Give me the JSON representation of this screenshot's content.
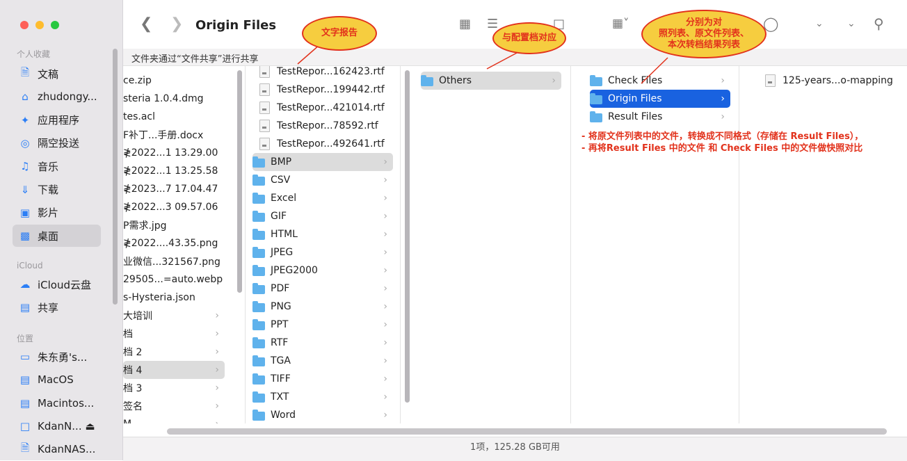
{
  "window": {
    "title": "Origin Files"
  },
  "sharebar": {
    "text": "文件夹通过“文件共享”进行共享"
  },
  "status": {
    "text": "1项，125.28 GB可用"
  },
  "sidebar": {
    "favorites_header": "个人收藏",
    "icloud_header": "iCloud",
    "locations_header": "位置",
    "favorites": [
      {
        "label": "文稿",
        "icon": "document-icon"
      },
      {
        "label": "zhudongy...",
        "icon": "home-icon"
      },
      {
        "label": "应用程序",
        "icon": "applications-icon"
      },
      {
        "label": "隔空投送",
        "icon": "airdrop-icon"
      },
      {
        "label": "音乐",
        "icon": "music-icon"
      },
      {
        "label": "下载",
        "icon": "download-icon"
      },
      {
        "label": "影片",
        "icon": "film-icon"
      },
      {
        "label": "桌面",
        "icon": "desktop-icon"
      }
    ],
    "icloud": [
      {
        "label": "iCloud云盘",
        "icon": "cloud-icon"
      },
      {
        "label": "共享",
        "icon": "shared-folder-icon"
      }
    ],
    "locations": [
      {
        "label": "朱东勇's...",
        "icon": "laptop-icon"
      },
      {
        "label": "MacOS",
        "icon": "drive-icon"
      },
      {
        "label": "Macintos...",
        "icon": "drive-icon"
      },
      {
        "label": "KdanN... ⏏",
        "icon": "server-icon"
      },
      {
        "label": "KdanNAS...",
        "icon": "document-icon"
      }
    ]
  },
  "columns": {
    "col1": [
      "ce.zip",
      "steria 1.0.4.dmg",
      "tes.acl",
      "F补丁...手册.docx",
      "≹2022...1 13.29.00",
      "≹2022...1 13.25.58",
      "≹2023...7 17.04.47",
      "≹2022...3 09.57.06",
      "P需求.jpg",
      "≹2022....43.35.png",
      "业微信...321567.png",
      "29505...=auto.webp",
      "s-Hysteria.json",
      "大培训",
      "档",
      "档 2",
      "档 4",
      "档 3",
      "签名",
      "M"
    ],
    "col2_files": [
      "TestRepor...162423.rtf",
      "TestRepor...199442.rtf",
      "TestRepor...421014.rtf",
      "TestRepor...78592.rtf",
      "TestRepor...492641.rtf"
    ],
    "col2_folders": [
      "BMP",
      "CSV",
      "Excel",
      "GIF",
      "HTML",
      "JPEG",
      "JPEG2000",
      "PDF",
      "PNG",
      "PPT",
      "RTF",
      "TGA",
      "TIFF",
      "TXT",
      "Word"
    ],
    "col3": [
      "Others"
    ],
    "col4": [
      "Check Files",
      "Origin Files",
      "Result Files"
    ],
    "col5": [
      "125-years...o-mapping"
    ]
  },
  "annotations": {
    "callout1": "文字报告",
    "callout2": "与配置档对应",
    "callout3": [
      "分别为对",
      "照列表、原文件列表、",
      "本次转档结果列表"
    ],
    "note_line1": "- 将原文件列表中的文件，转换成不同格式（存储在 Result Files），",
    "note_line2": "- 再将Result Files 中的文件 和 Check Files 中的文件做快照对比"
  },
  "colors": {
    "accent": "#1962e0",
    "annotation": "#e2321c",
    "callout_fill": "#f6cd3f",
    "folder": "#5fb2ec"
  }
}
